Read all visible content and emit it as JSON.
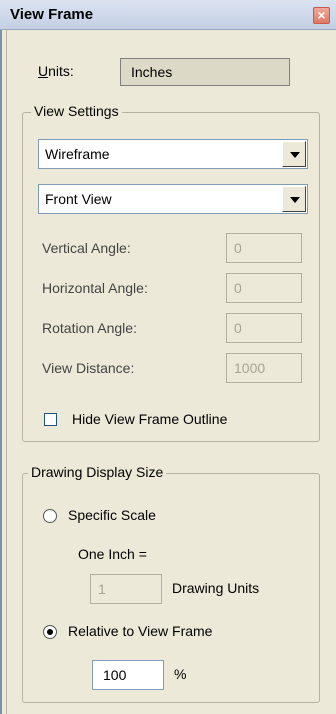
{
  "window": {
    "title": "View Frame",
    "close_glyph": "×"
  },
  "units": {
    "label": "Units:",
    "label_access_key": "U",
    "label_rest": "nits:",
    "value": "Inches"
  },
  "view_settings": {
    "legend": "View Settings",
    "render_mode": "Wireframe",
    "view": "Front View",
    "fields": [
      {
        "label": "Vertical Angle:",
        "value": "0"
      },
      {
        "label": "Horizontal Angle:",
        "value": "0"
      },
      {
        "label": "Rotation Angle:",
        "value": "0"
      },
      {
        "label": "View Distance:",
        "value": "1000"
      }
    ],
    "hide_outline": {
      "label": "Hide View Frame Outline",
      "checked": false
    }
  },
  "drawing_display": {
    "legend": "Drawing Display Size",
    "specific_scale": {
      "label": "Specific Scale",
      "selected": false
    },
    "one_inch_label": "One Inch =",
    "scale_value": "1",
    "drawing_units_label": "Drawing Units",
    "relative": {
      "label": "Relative to View Frame",
      "selected": true
    },
    "percent_value": "100",
    "percent_label": "%"
  }
}
